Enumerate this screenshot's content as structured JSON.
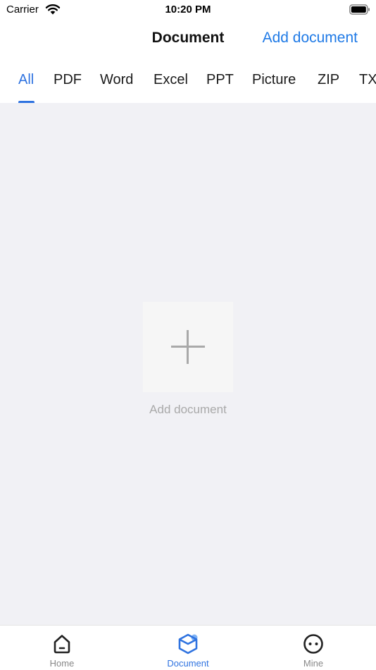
{
  "status_bar": {
    "carrier": "Carrier",
    "time": "10:20 PM"
  },
  "nav": {
    "title": "Document",
    "action": "Add document"
  },
  "tabs": [
    {
      "label": "All",
      "active": true
    },
    {
      "label": "PDF"
    },
    {
      "label": "Word"
    },
    {
      "label": "Excel"
    },
    {
      "label": "PPT"
    },
    {
      "label": "Picture"
    },
    {
      "label": "ZIP"
    },
    {
      "label": "TXT"
    }
  ],
  "empty_state": {
    "label": "Add document"
  },
  "tab_bar": [
    {
      "label": "Home",
      "icon": "home-icon"
    },
    {
      "label": "Document",
      "icon": "document-box-icon",
      "active": true
    },
    {
      "label": "Mine",
      "icon": "smiley-face-icon"
    }
  ],
  "colors": {
    "accent": "#2f73e0",
    "link": "#1f7ae6",
    "content_bg": "#f1f1f5"
  }
}
